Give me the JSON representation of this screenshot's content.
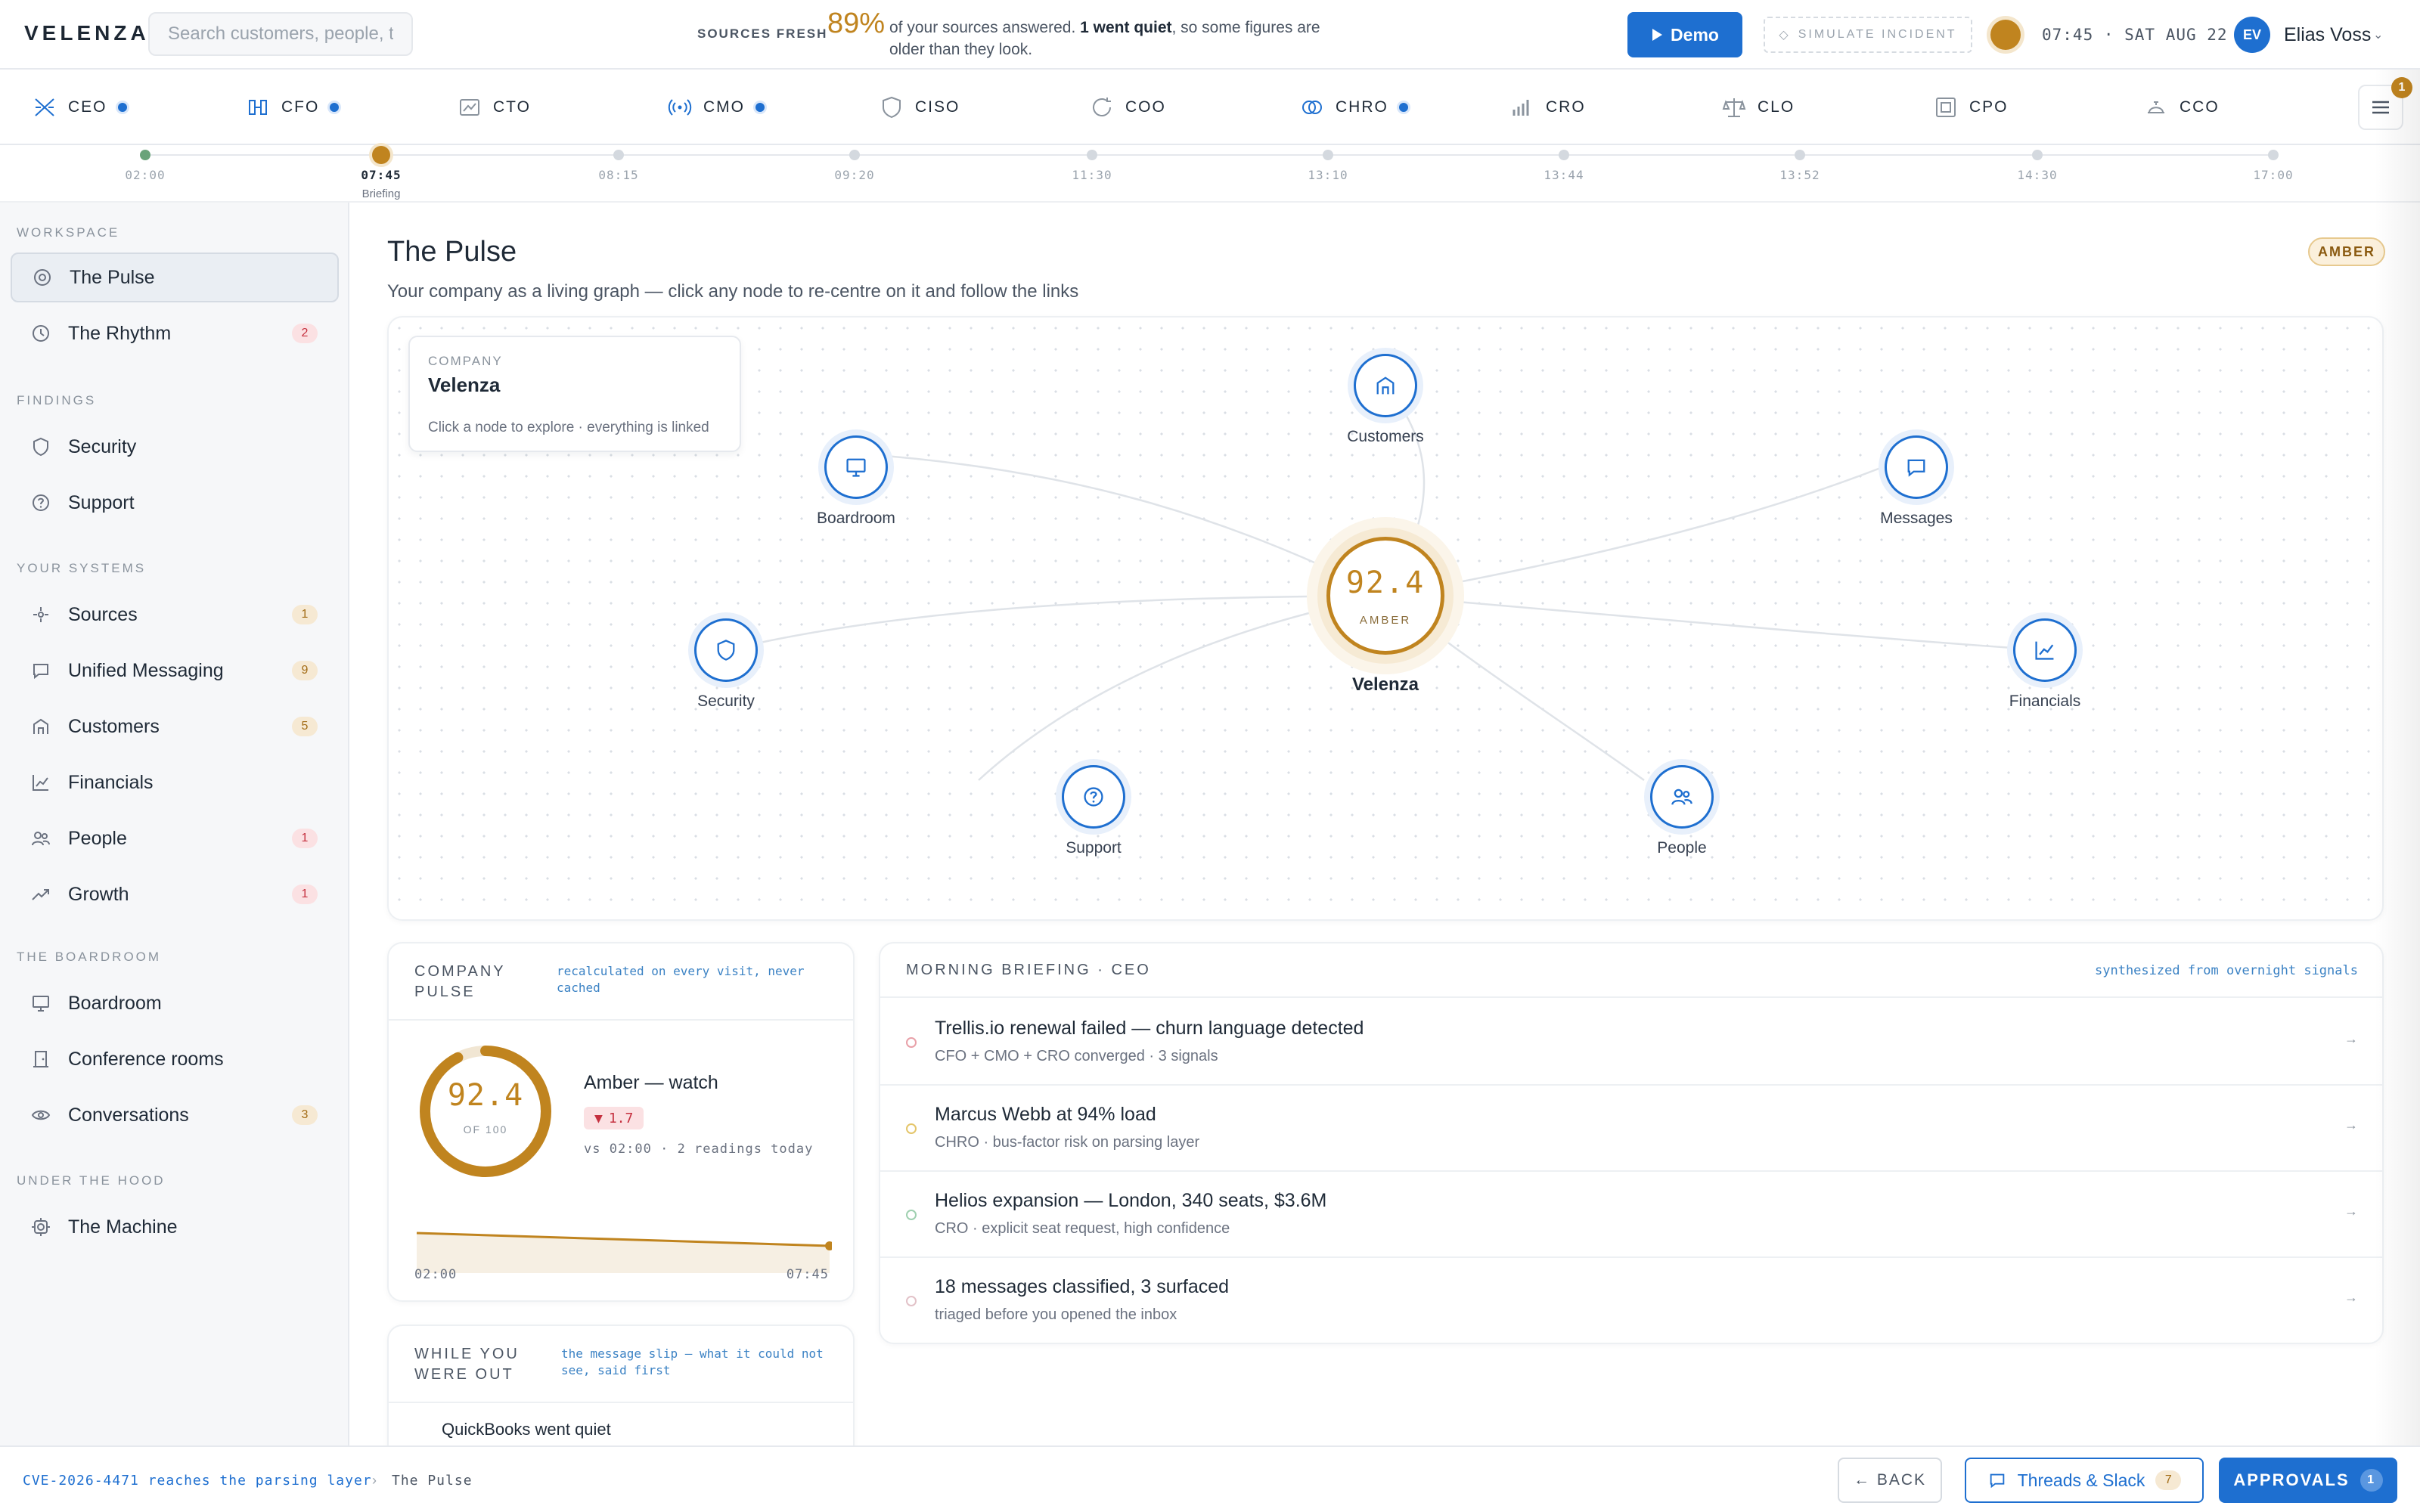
{
  "app": {
    "logo": "VELENZA."
  },
  "search": {
    "placeholder": "Search customers, people, ti"
  },
  "freshness": {
    "label": "SOURCES FRESH",
    "percent": "89%",
    "text_before": "of your sources answered.",
    "text_bold": "1 went quiet",
    "text_after": ", so some figures are older than they look."
  },
  "header": {
    "demo_label": "Demo",
    "simulate_label": "SIMULATE INCIDENT",
    "clock": "07:45 · SAT AUG 22",
    "user_initials": "EV",
    "user_name": "Elias Voss"
  },
  "roles": [
    {
      "label": "CEO",
      "icon": "ceo-icon",
      "dot": true
    },
    {
      "label": "CFO",
      "icon": "cfo-icon",
      "dot": true
    },
    {
      "label": "CTO",
      "icon": "cto-icon",
      "dot": false
    },
    {
      "label": "CMO",
      "icon": "cmo-icon",
      "dot": true
    },
    {
      "label": "CISO",
      "icon": "ciso-icon",
      "dot": false
    },
    {
      "label": "COO",
      "icon": "coo-icon",
      "dot": false
    },
    {
      "label": "CHRO",
      "icon": "chro-icon",
      "dot": true
    },
    {
      "label": "CRO",
      "icon": "cro-icon",
      "dot": false
    },
    {
      "label": "CLO",
      "icon": "clo-icon",
      "dot": false
    },
    {
      "label": "CPO",
      "icon": "cpo-icon",
      "dot": false
    },
    {
      "label": "CCO",
      "icon": "cco-icon",
      "dot": false
    }
  ],
  "menu": {
    "badge": "1",
    "icon": "hamburger-menu-icon"
  },
  "timeline": {
    "points": [
      "02:00",
      "07:45",
      "08:15",
      "09:20",
      "11:30",
      "13:10",
      "13:44",
      "13:52",
      "14:30",
      "17:00"
    ],
    "active_index": 1,
    "active_sub": "Briefing"
  },
  "sidebar": {
    "sections": [
      {
        "title": "WORKSPACE",
        "items": [
          {
            "label": "The Pulse",
            "icon": "pulse-target-icon",
            "badge": "",
            "active": true
          },
          {
            "label": "The Rhythm",
            "icon": "clock-icon",
            "badge": "2",
            "badge_tone": "red"
          }
        ]
      },
      {
        "title": "FINDINGS",
        "items": [
          {
            "label": "Security",
            "icon": "shield-icon",
            "badge": ""
          },
          {
            "label": "Support",
            "icon": "help-circle-icon",
            "badge": ""
          }
        ]
      },
      {
        "title": "YOUR SYSTEMS",
        "items": [
          {
            "label": "Sources",
            "icon": "sources-hub-icon",
            "badge": "1",
            "badge_tone": "amber"
          },
          {
            "label": "Unified Messaging",
            "icon": "message-icon",
            "badge": "9",
            "badge_tone": "amber"
          },
          {
            "label": "Customers",
            "icon": "storefront-icon",
            "badge": "5",
            "badge_tone": "amber"
          },
          {
            "label": "Financials",
            "icon": "line-chart-icon",
            "badge": ""
          },
          {
            "label": "People",
            "icon": "people-icon",
            "badge": "1",
            "badge_tone": "red"
          },
          {
            "label": "Growth",
            "icon": "trending-up-icon",
            "badge": "1",
            "badge_tone": "red"
          }
        ]
      },
      {
        "title": "THE BOARDROOM",
        "items": [
          {
            "label": "Boardroom",
            "icon": "monitor-icon",
            "badge": ""
          },
          {
            "label": "Conference rooms",
            "icon": "door-icon",
            "badge": ""
          },
          {
            "label": "Conversations",
            "icon": "eye-icon",
            "badge": "3",
            "badge_tone": "amber"
          }
        ]
      },
      {
        "title": "UNDER THE HOOD",
        "items": [
          {
            "label": "The Machine",
            "icon": "gear-icon",
            "badge": ""
          }
        ]
      }
    ]
  },
  "page": {
    "title": "The Pulse",
    "subtitle": "Your company as a living graph — click any node to re-centre on it and follow the links",
    "state_pill": "AMBER"
  },
  "graph": {
    "info_key": "COMPANY",
    "info_name": "Velenza",
    "info_hint": "Click a node to explore · everything is linked",
    "center": {
      "score": "92.4",
      "state": "AMBER",
      "name": "Velenza"
    },
    "nodes": [
      {
        "label": "Customers",
        "icon": "storefront-icon"
      },
      {
        "label": "Boardroom",
        "icon": "monitor-icon"
      },
      {
        "label": "Messages",
        "icon": "message-icon"
      },
      {
        "label": "Security",
        "icon": "shield-icon"
      },
      {
        "label": "Financials",
        "icon": "line-chart-icon"
      },
      {
        "label": "Support",
        "icon": "help-circle-icon"
      },
      {
        "label": "People",
        "icon": "people-icon"
      }
    ]
  },
  "pulse": {
    "title": "COMPANY PULSE",
    "note": "recalculated on every visit, never cached",
    "score": "92.4",
    "of": "OF 100",
    "score_fraction": 0.924,
    "state": "Amber — watch",
    "delta": "1.7",
    "vs": "vs 02:00 · 2 readings today",
    "spark": {
      "start_label": "02:00",
      "end_label": "07:45",
      "values": [
        94.1,
        92.4
      ]
    },
    "accent_color": "#c0841f"
  },
  "away": {
    "title": "WHILE YOU WERE OUT",
    "note": "the message slip — what it could not see, said first",
    "item": "QuickBooks went quiet"
  },
  "briefing": {
    "title": "MORNING BRIEFING · CEO",
    "note": "synthesized from overnight signals",
    "items": [
      {
        "title": "Trellis.io renewal failed — churn language detected",
        "sub": "CFO + CMO + CRO converged · 3 signals",
        "tone": "#e8a0a8"
      },
      {
        "title": "Marcus Webb at 94% load",
        "sub": "CHRO · bus-factor risk on parsing layer",
        "tone": "#e4c56a"
      },
      {
        "title": "Helios expansion — London, 340 seats, $3.6M",
        "sub": "CRO · explicit seat request, high confidence",
        "tone": "#9fd0b0"
      },
      {
        "title": "18 messages classified, 3 surfaced",
        "sub": "triaged before you opened the inbox",
        "tone": "#e2c2c8"
      }
    ]
  },
  "footer": {
    "crumb_link": "CVE-2026-4471 reaches the parsing layer",
    "crumb_sep": "›",
    "crumb_page": "The Pulse",
    "back_label": "← BACK",
    "threads_label": "Threads & Slack",
    "threads_badge": "7",
    "approvals_label": "APPROVALS",
    "approvals_badge": "1"
  }
}
